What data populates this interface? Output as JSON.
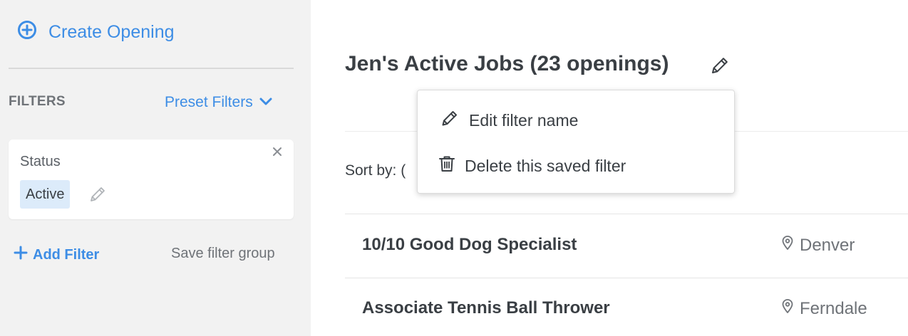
{
  "sidebar": {
    "create_opening": "Create Opening",
    "filters_heading": "FILTERS",
    "preset_filters": "Preset Filters",
    "filter_card": {
      "label": "Status",
      "value": "Active"
    },
    "add_filter": "Add Filter",
    "save_filter_group": "Save filter group"
  },
  "main": {
    "title": "Jen's Active Jobs (23 openings)",
    "sort_by_label": "Sort by: (",
    "jobs": [
      {
        "title": "10/10 Good Dog Specialist",
        "location": "Denver"
      },
      {
        "title": "Associate Tennis Ball Thrower",
        "location": "Ferndale"
      }
    ]
  },
  "dropdown": {
    "items": [
      {
        "label": "Edit filter name",
        "icon": "pencil-icon"
      },
      {
        "label": "Delete this saved filter",
        "icon": "trash-icon"
      }
    ]
  },
  "colors": {
    "accent": "#3d8de5",
    "sidebar_bg": "#f2f2f2",
    "chip_bg": "#dcebfa",
    "text_dark": "#3a3f44",
    "text_muted": "#6f7378"
  }
}
